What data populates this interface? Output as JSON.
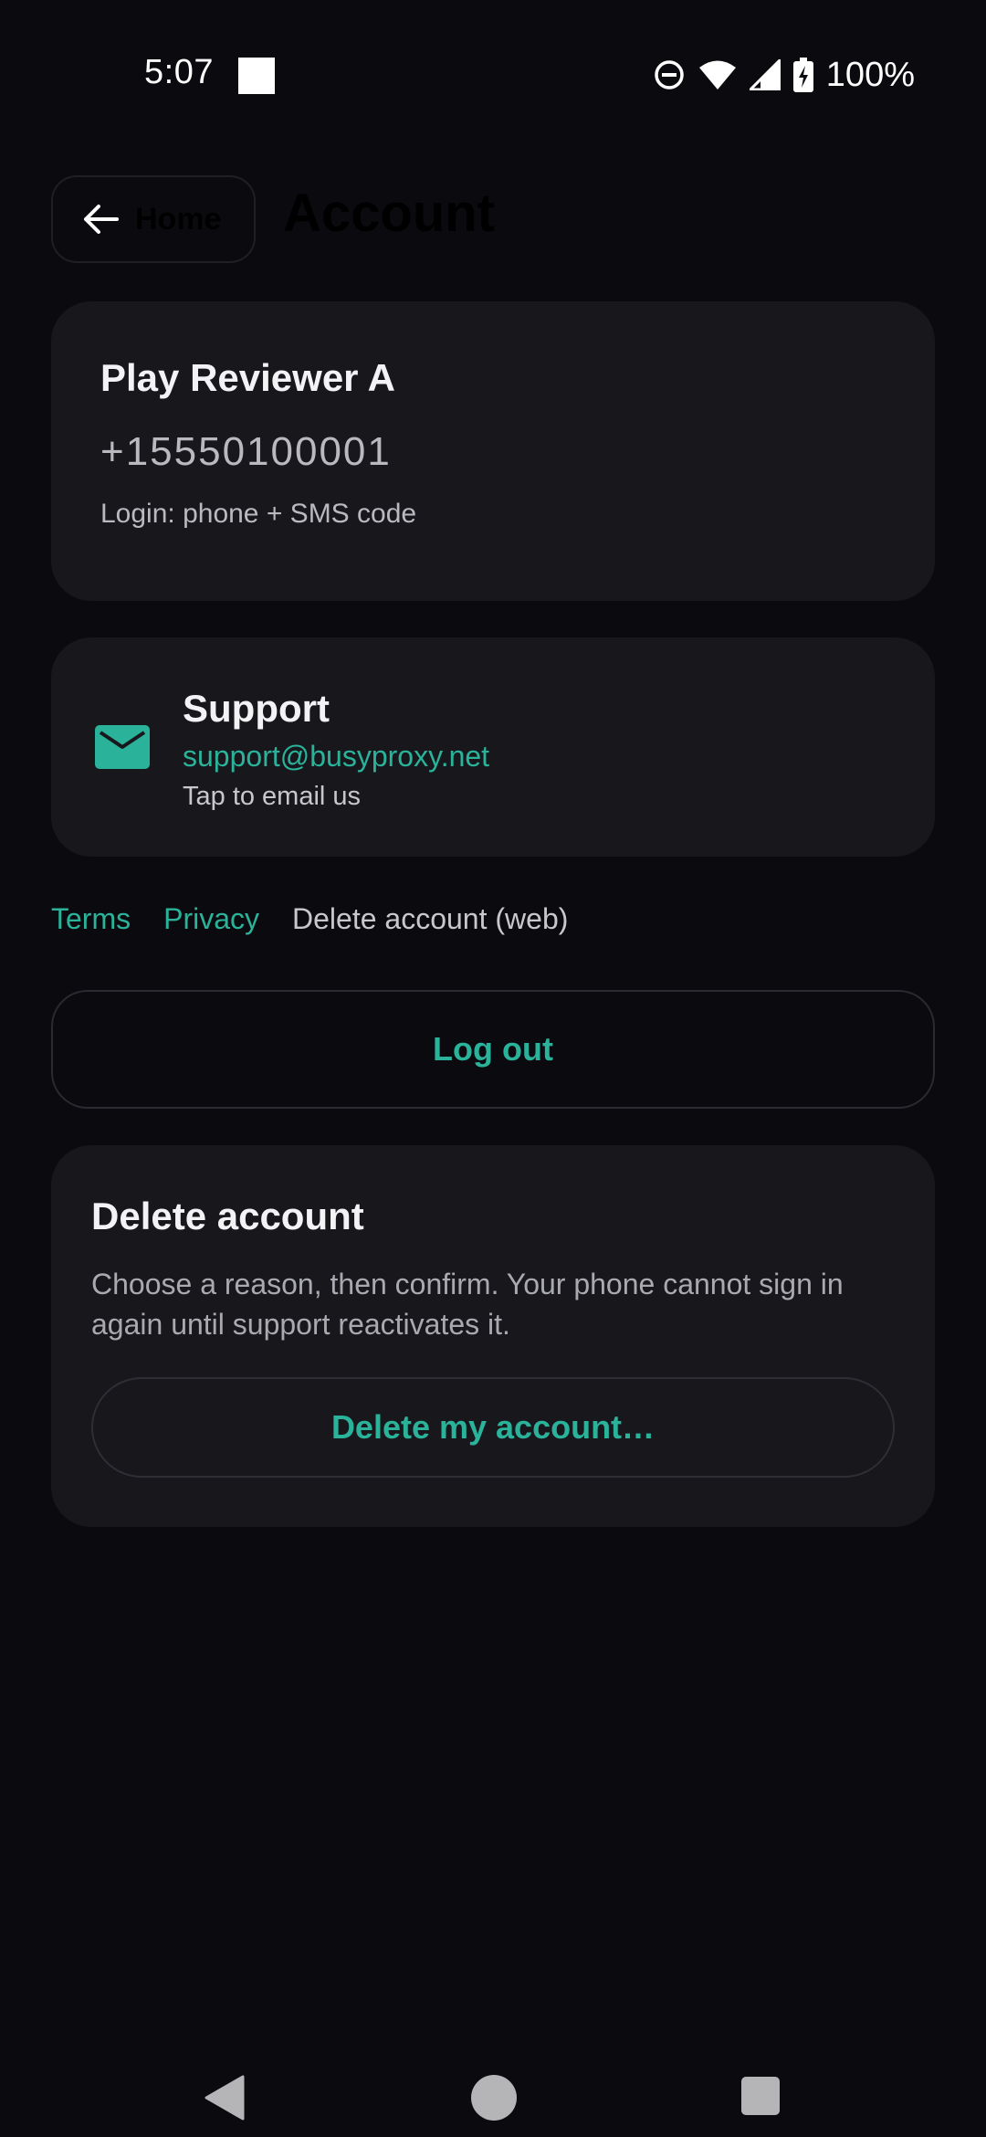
{
  "status_bar": {
    "time": "5:07",
    "battery_percent": "100%",
    "icons": [
      "dnd-icon",
      "wifi-icon",
      "signal-icon",
      "battery-charging-icon"
    ]
  },
  "header": {
    "back_label": "Home",
    "title": "Account"
  },
  "profile": {
    "name": "Play Reviewer A",
    "phone": "+15550100001",
    "login_method": "Login: phone + SMS code"
  },
  "support": {
    "title": "Support",
    "email": "support@busyproxy.net",
    "hint": "Tap to email us",
    "icon": "mail-icon"
  },
  "links": {
    "terms": "Terms",
    "privacy": "Privacy",
    "delete_web": "Delete account (web)"
  },
  "logout_label": "Log out",
  "delete_section": {
    "title": "Delete account",
    "description": "Choose a reason, then confirm. Your phone cannot sign in again until support reactivates it.",
    "button_label": "Delete my account…"
  },
  "colors": {
    "accent": "#2ab39a",
    "background": "#0b0b0f",
    "card": "#17171c"
  }
}
